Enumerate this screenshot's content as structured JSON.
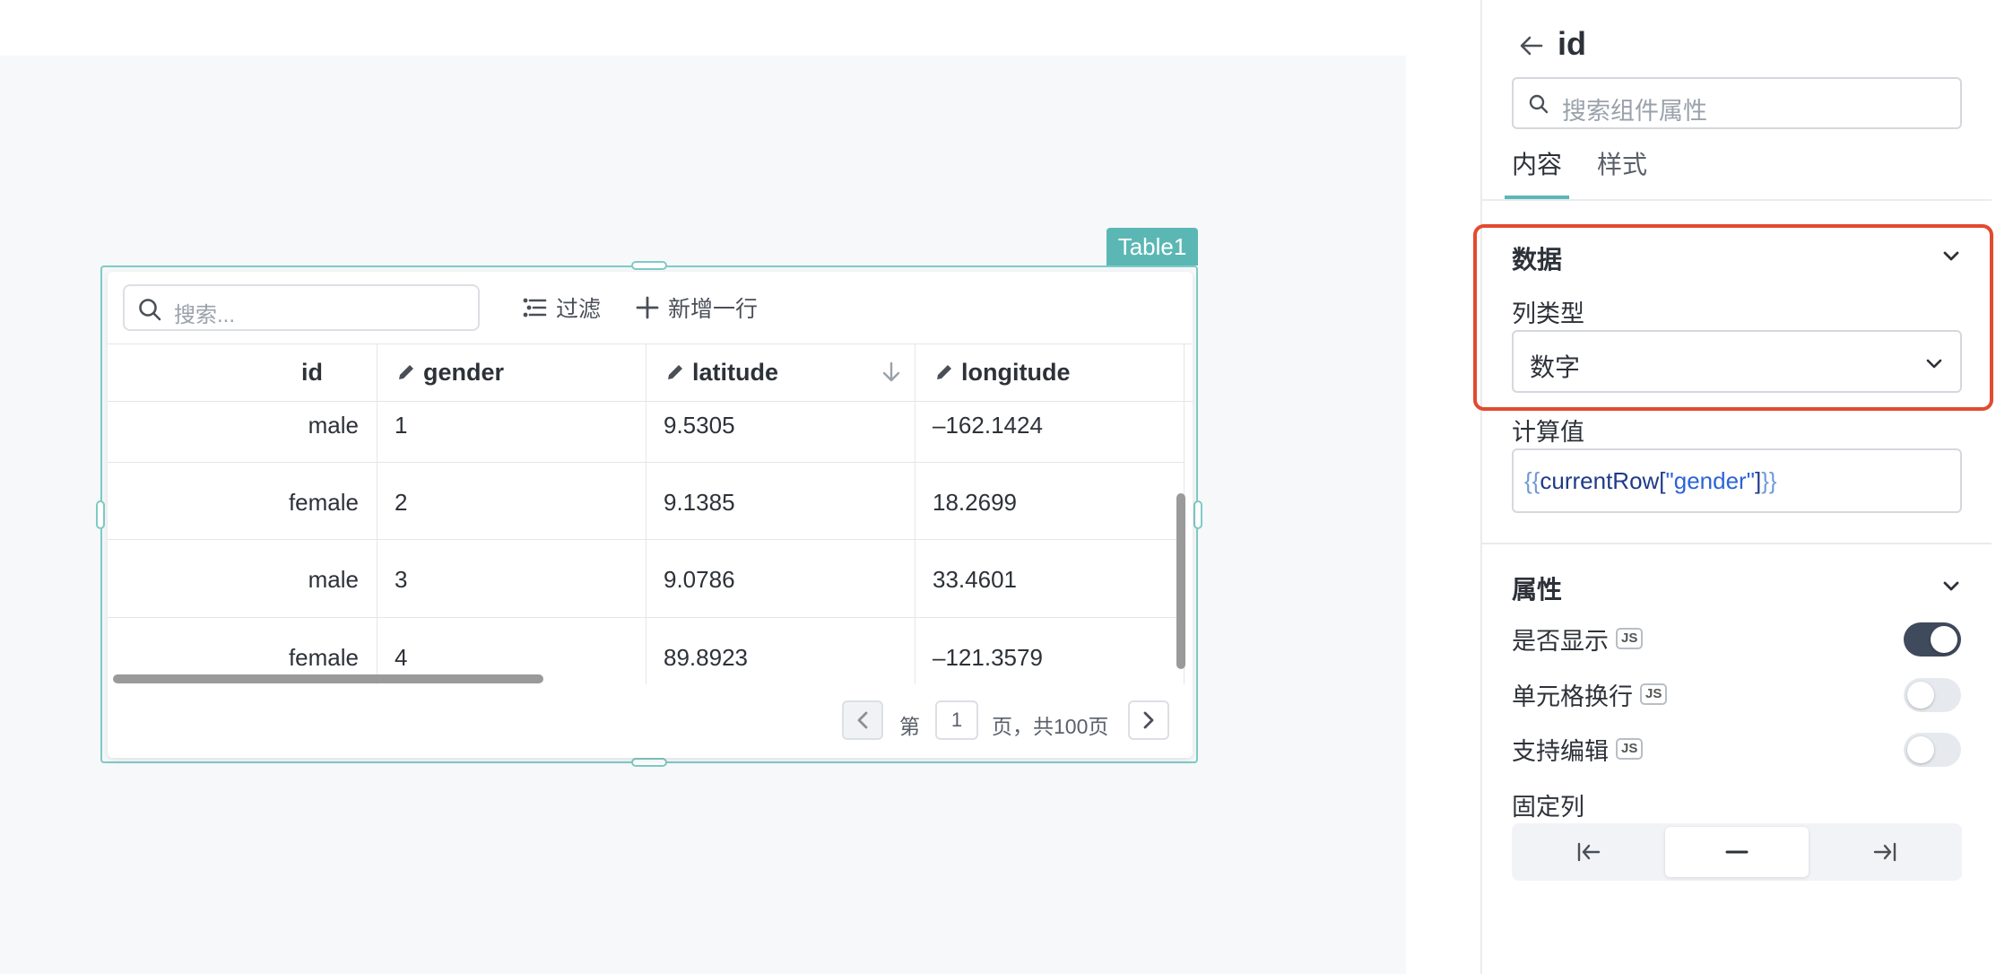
{
  "table": {
    "tag": "Table1",
    "toolbar": {
      "search_placeholder": "搜索...",
      "filter_label": "过滤",
      "add_row_label": "新增一行"
    },
    "columns": [
      "id",
      "gender",
      "latitude",
      "longitude"
    ],
    "rows": [
      [
        "male",
        "1",
        "9.5305",
        "–162.1424"
      ],
      [
        "female",
        "2",
        "9.1385",
        "18.2699"
      ],
      [
        "male",
        "3",
        "9.0786",
        "33.4601"
      ],
      [
        "female",
        "4",
        "89.8923",
        "–121.3579"
      ]
    ],
    "pager": {
      "prefix": "第",
      "page": "1",
      "suffix": "页，共100页"
    }
  },
  "panel": {
    "title": "id",
    "search_placeholder": "搜索组件属性",
    "tabs": [
      "内容",
      "样式"
    ],
    "active_tab": "内容",
    "data_section": {
      "title": "数据",
      "column_type_label": "列类型",
      "column_type_value": "数字",
      "computed_label": "计算值",
      "computed_open": "{{",
      "computed_ident": "currentRow[",
      "computed_string": "\"gender\"",
      "computed_close_bracket": "]",
      "computed_close": "}}"
    },
    "attr_section": {
      "title": "属性",
      "show_label": "是否显示",
      "wrap_label": "单元格换行",
      "edit_label": "支持编辑",
      "js_badge": "JS",
      "show_on": true,
      "wrap_on": false,
      "edit_on": false,
      "fixed_column_label": "固定列",
      "fixed_active": "none"
    }
  },
  "colors": {
    "accent": "#5bb7b4",
    "highlight": "#e34a2f",
    "toggle_on": "#3f4a5c",
    "toggle_off": "#e6e9ee"
  }
}
